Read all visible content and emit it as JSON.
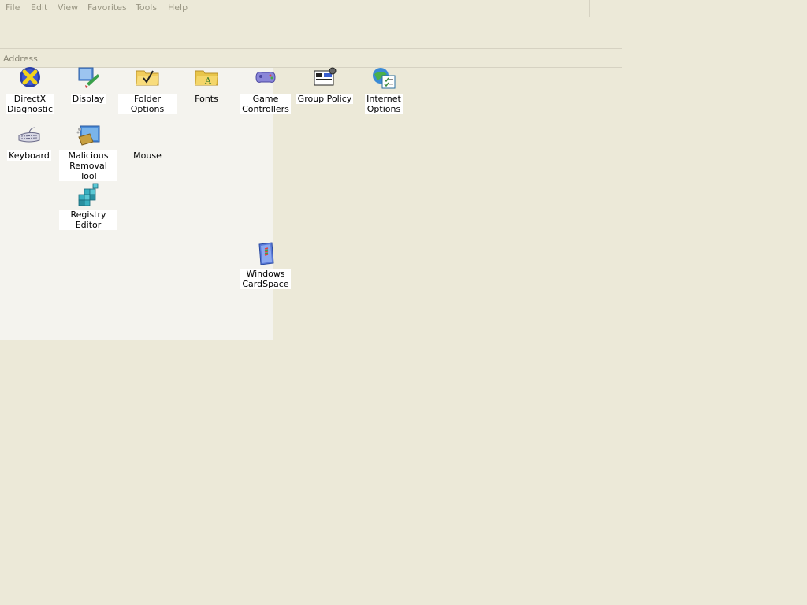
{
  "menu": {
    "items": [
      "File",
      "Edit",
      "View",
      "Favorites",
      "Tools",
      "Help"
    ]
  },
  "address": {
    "label": "Address"
  },
  "icons": [
    {
      "label": "DirectX\nDiagnostic",
      "icon": "directx-icon"
    },
    {
      "label": "Display",
      "icon": "display-icon"
    },
    {
      "label": "Folder Options",
      "icon": "folder-options-icon"
    },
    {
      "label": "Fonts",
      "icon": "fonts-folder-icon"
    },
    {
      "label": "Game\nControllers",
      "icon": "game-controller-icon"
    },
    {
      "label": "Group Policy",
      "icon": "group-policy-icon"
    },
    {
      "label": "Internet\nOptions",
      "icon": "internet-options-icon"
    },
    {
      "label": "Keyboard",
      "icon": "keyboard-icon"
    },
    {
      "label": "Malicious\nRemoval Tool",
      "icon": "malicious-removal-tool-icon"
    },
    {
      "label": "Mouse",
      "icon": "mouse-icon"
    },
    {
      "label": "Registry Editor",
      "icon": "registry-editor-icon"
    },
    {
      "label": "Windows\nCardSpace",
      "icon": "cardspace-icon"
    }
  ]
}
